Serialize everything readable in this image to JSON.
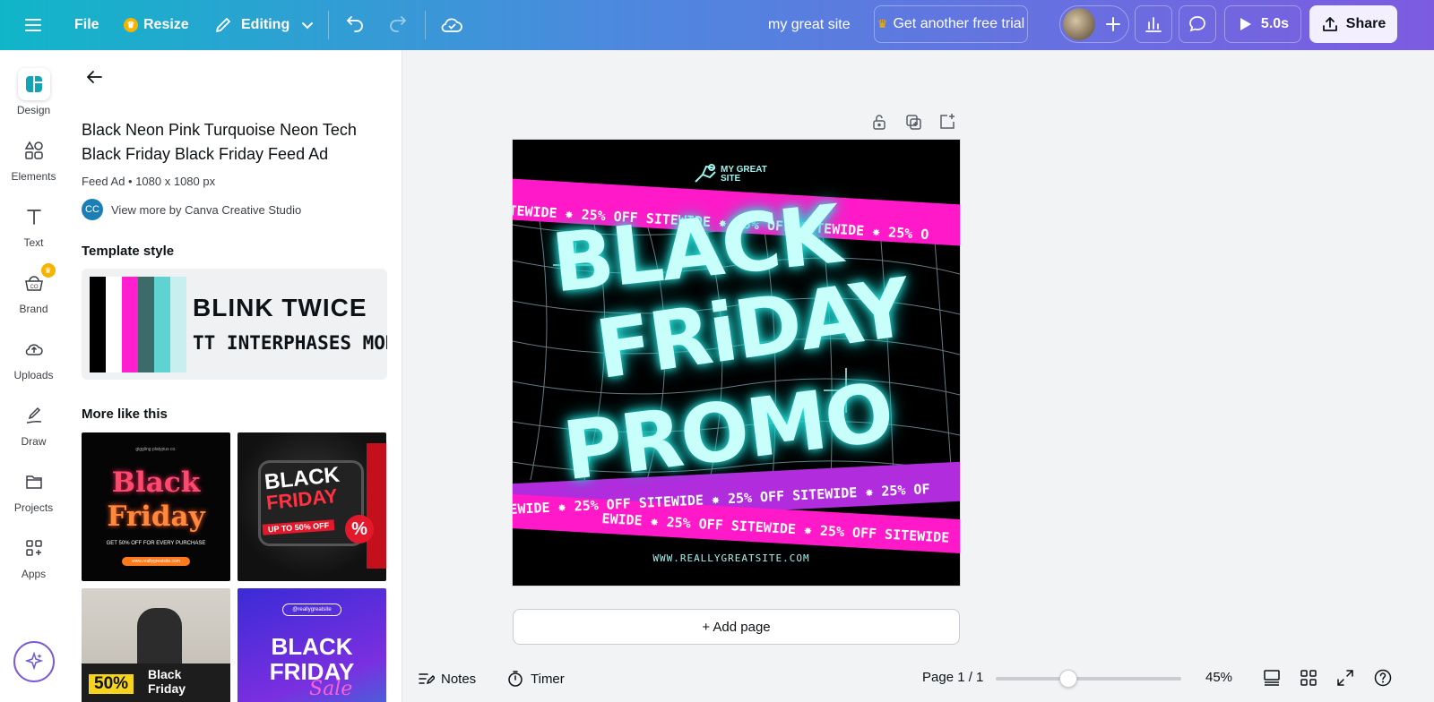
{
  "topbar": {
    "file_label": "File",
    "resize_label": "Resize",
    "editing_label": "Editing",
    "site_name": "my great site",
    "trial_label": "Get another free trial",
    "play_label": "5.0s",
    "share_label": "Share"
  },
  "rail": {
    "items": [
      {
        "label": "Design"
      },
      {
        "label": "Elements"
      },
      {
        "label": "Text"
      },
      {
        "label": "Brand"
      },
      {
        "label": "Uploads"
      },
      {
        "label": "Draw"
      },
      {
        "label": "Projects"
      },
      {
        "label": "Apps"
      }
    ]
  },
  "panel": {
    "title": "Black Neon Pink Turquoise Neon Tech Black Friday Black Friday Feed Ad",
    "meta": "Feed Ad • 1080 x 1080 px",
    "creator_initials": "CC",
    "creator_link": "View more by Canva Creative Studio",
    "template_style_heading": "Template style",
    "font_heading_sample": "BLINK TWICE",
    "font_body_sample": "TT INTERPHASES MONO",
    "colors": [
      "#000000",
      "#ffffff",
      "#ff1fcf",
      "#3c6b6a",
      "#5fd3d2",
      "#c8eff0"
    ],
    "more_heading": "More like this",
    "thumbs": [
      {
        "brand": "giggling platypus co.",
        "line1": "Black",
        "line2": "Friday",
        "sub": "GET 50% OFF FOR EVERY PURCHASE",
        "pill": "www.reallygreatsite.com"
      },
      {
        "line1": "BLACK",
        "line2": "FRIDAY",
        "sub": "UP TO 50% OFF",
        "badge": "%"
      },
      {
        "tag": "50%",
        "line1": "Black",
        "line2": "Friday"
      },
      {
        "handle": "@reallygreatsite",
        "line1": "BLACK",
        "line2": "FRIDAY",
        "script": "Sale"
      }
    ]
  },
  "design": {
    "brand_line1": "MY GREAT",
    "brand_line2": "SITE",
    "banner_text": "TEWIDE ✸ 25% OFF SITEWIDE ✸ 25% OFF SITEWIDE ✸ 25% O",
    "banner2_text": "EWIDE ✸ 25% OFF SITEWIDE ✸ 25% OFF SITEWIDE ✸ 25% OF",
    "banner3_text": "EWIDE ✸ 25% OFF SITEWIDE ✸ 25% OFF SITEWIDE",
    "headline1": "BLACK",
    "headline2": "FRiDAY",
    "headline3": "PROMO",
    "url": "WWW.REALLYGREATSITE.COM"
  },
  "canvas": {
    "add_page_label": "+ Add page"
  },
  "bottombar": {
    "notes_label": "Notes",
    "timer_label": "Timer",
    "page_label": "Page 1 / 1",
    "zoom_label": "45%",
    "zoom_level": 0.45
  }
}
